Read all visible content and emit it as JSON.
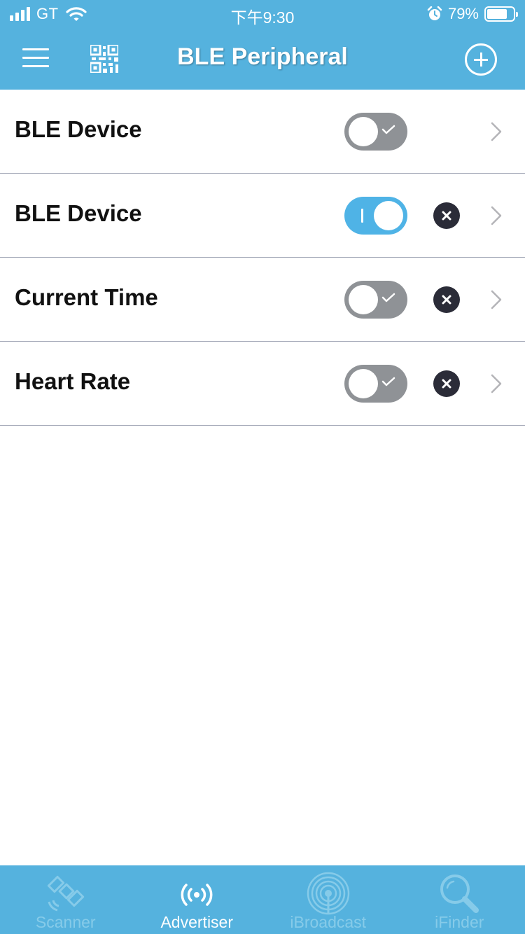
{
  "status_bar": {
    "carrier": "GT",
    "time": "下午9:30",
    "battery_percent": "79%",
    "battery_level": 0.79,
    "icons": [
      "signal-icon",
      "wifi-icon",
      "alarm-icon",
      "battery-icon"
    ]
  },
  "nav": {
    "title": "BLE Peripheral",
    "icons": [
      "hamburger-menu-icon",
      "qr-code-icon",
      "add-circle-icon"
    ]
  },
  "rows": [
    {
      "label": "BLE Device",
      "enabled": false,
      "deletable": false
    },
    {
      "label": "BLE Device",
      "enabled": true,
      "deletable": true
    },
    {
      "label": "Current Time",
      "enabled": false,
      "deletable": true
    },
    {
      "label": "Heart Rate",
      "enabled": false,
      "deletable": true
    }
  ],
  "tabs": [
    {
      "label": "Scanner",
      "active": false,
      "icon": "satellite-icon"
    },
    {
      "label": "Advertiser",
      "active": true,
      "icon": "broadcast-icon"
    },
    {
      "label": "iBroadcast",
      "active": false,
      "icon": "ibeacon-icon"
    },
    {
      "label": "iFinder",
      "active": false,
      "icon": "magnifier-icon"
    }
  ],
  "colors": {
    "header_bg": "#55b2de",
    "toggle_on": "#4fb3e6",
    "toggle_off": "#8f9296",
    "delete_bg": "#2b2c38",
    "tab_inactive": "#86cbe9",
    "tab_active": "#ffffff"
  }
}
